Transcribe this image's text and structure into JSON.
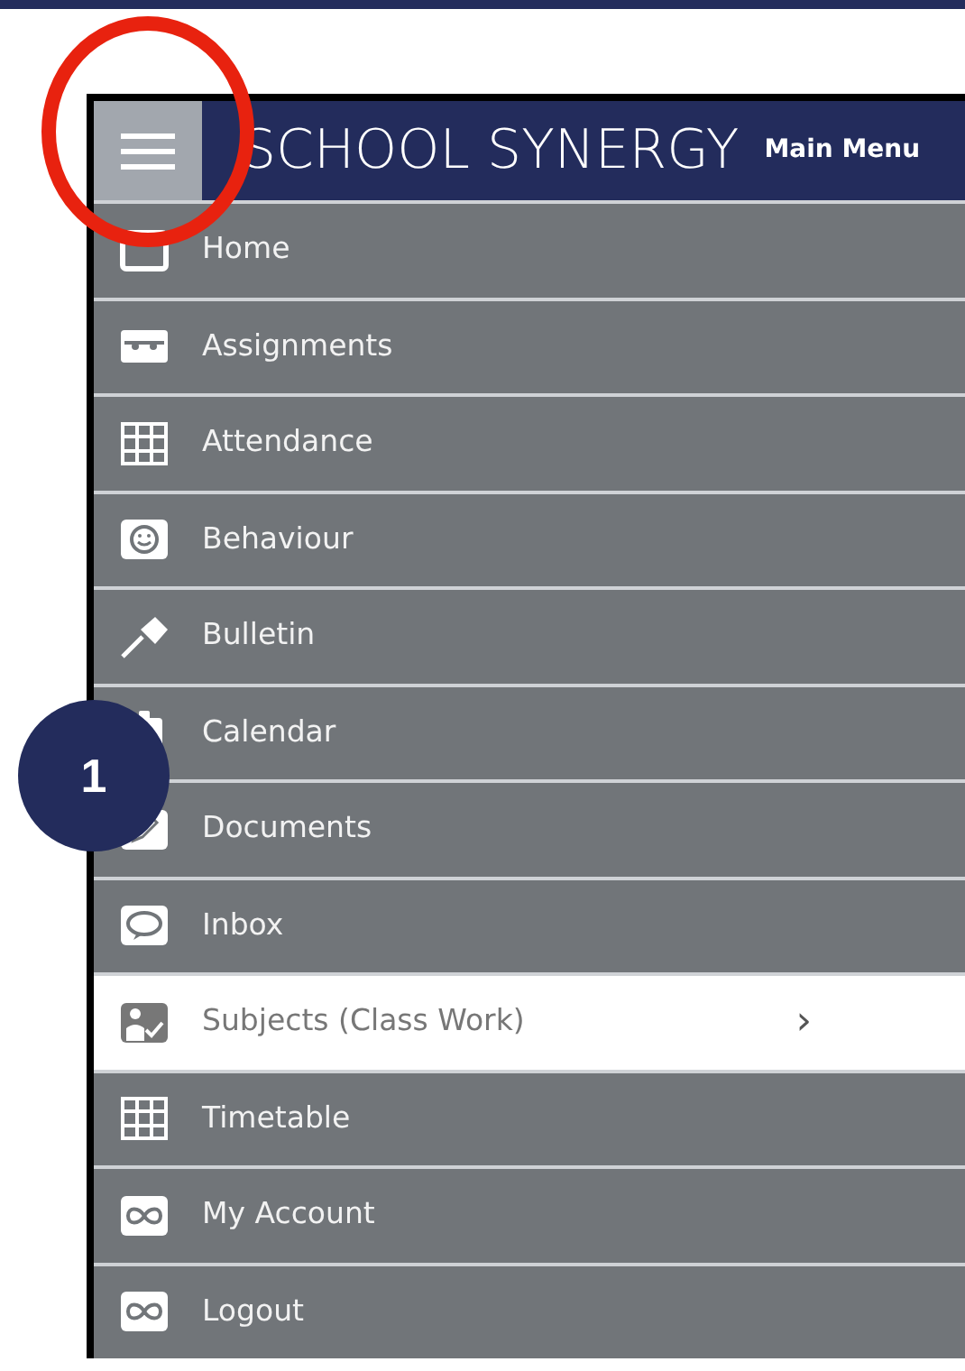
{
  "header": {
    "logo": "SCHOOL SYNERGY",
    "title": "Main Menu"
  },
  "menu": [
    {
      "label": "Home",
      "selected": false
    },
    {
      "label": "Assignments",
      "selected": false
    },
    {
      "label": "Attendance",
      "selected": false
    },
    {
      "label": "Behaviour",
      "selected": false
    },
    {
      "label": "Bulletin",
      "selected": false
    },
    {
      "label": "Calendar",
      "selected": false
    },
    {
      "label": "Documents",
      "selected": false
    },
    {
      "label": "Inbox",
      "selected": false
    },
    {
      "label": "Subjects (Class Work)",
      "selected": true,
      "chevron": "›"
    },
    {
      "label": "Timetable",
      "selected": false
    },
    {
      "label": "My Account",
      "selected": false
    },
    {
      "label": "Logout",
      "selected": false
    }
  ],
  "callout": {
    "step": "1"
  }
}
